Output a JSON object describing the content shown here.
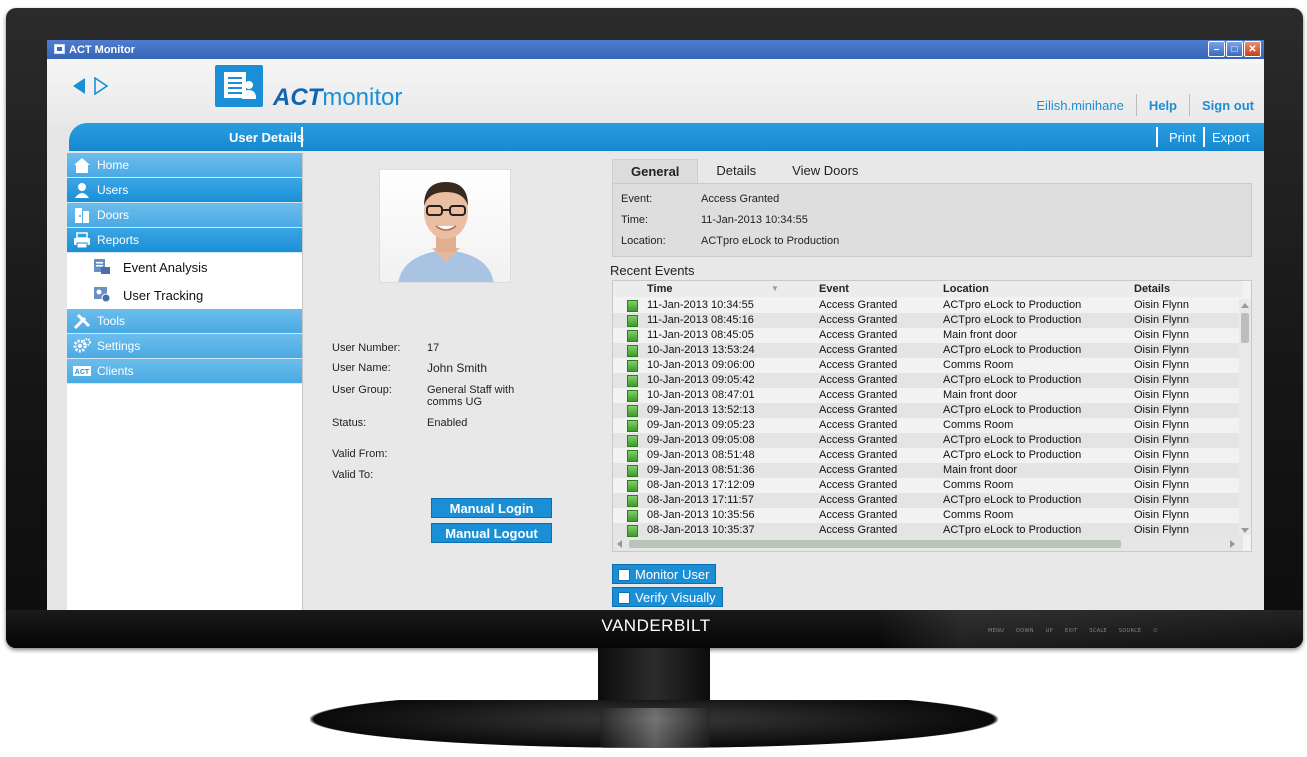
{
  "window": {
    "title": "ACT Monitor"
  },
  "header": {
    "logo_act": "ACT",
    "logo_monitor": "monitor",
    "username": "Eilish.minihane",
    "help": "Help",
    "sign_out": "Sign out"
  },
  "toolbar": {
    "section_title": "User Details",
    "print": "Print",
    "export": "Export"
  },
  "sidebar": {
    "items": [
      {
        "label": "Home"
      },
      {
        "label": "Users"
      },
      {
        "label": "Doors"
      },
      {
        "label": "Reports"
      },
      {
        "label": "Event Analysis"
      },
      {
        "label": "User Tracking"
      },
      {
        "label": "Tools"
      },
      {
        "label": "Settings"
      },
      {
        "label": "Clients"
      }
    ]
  },
  "user": {
    "number_label": "User Number:",
    "number": "17",
    "name_label": "User Name:",
    "name": "John Smith",
    "group_label": "User Group:",
    "group": "General Staff with comms UG",
    "status_label": "Status:",
    "status": "Enabled",
    "valid_from_label": "Valid From:",
    "valid_to_label": "Valid To:",
    "manual_login": "Manual Login",
    "manual_logout": "Manual Logout"
  },
  "tabs": [
    "General",
    "Details",
    "View Doors"
  ],
  "general": {
    "event_label": "Event:",
    "event": "Access Granted",
    "time_label": "Time:",
    "time": "11-Jan-2013 10:34:55",
    "location_label": "Location:",
    "location": "ACTpro eLock to Production"
  },
  "recent": {
    "title": "Recent Events",
    "columns": [
      "Time",
      "Event",
      "Location",
      "Details"
    ],
    "rows": [
      [
        "11-Jan-2013 10:34:55",
        "Access Granted",
        "ACTpro eLock to Production",
        "Oisin Flynn"
      ],
      [
        "11-Jan-2013 08:45:16",
        "Access Granted",
        "ACTpro eLock to Production",
        "Oisin Flynn"
      ],
      [
        "11-Jan-2013 08:45:05",
        "Access Granted",
        "Main front door",
        "Oisin Flynn"
      ],
      [
        "10-Jan-2013 13:53:24",
        "Access Granted",
        "ACTpro eLock to Production",
        "Oisin Flynn"
      ],
      [
        "10-Jan-2013 09:06:00",
        "Access Granted",
        "Comms Room",
        "Oisin Flynn"
      ],
      [
        "10-Jan-2013 09:05:42",
        "Access Granted",
        "ACTpro eLock to Production",
        "Oisin Flynn"
      ],
      [
        "10-Jan-2013 08:47:01",
        "Access Granted",
        "Main front door",
        "Oisin Flynn"
      ],
      [
        "09-Jan-2013 13:52:13",
        "Access Granted",
        "ACTpro eLock to Production",
        "Oisin Flynn"
      ],
      [
        "09-Jan-2013 09:05:23",
        "Access Granted",
        "Comms Room",
        "Oisin Flynn"
      ],
      [
        "09-Jan-2013 09:05:08",
        "Access Granted",
        "ACTpro eLock to Production",
        "Oisin Flynn"
      ],
      [
        "09-Jan-2013 08:51:48",
        "Access Granted",
        "ACTpro eLock to Production",
        "Oisin Flynn"
      ],
      [
        "09-Jan-2013 08:51:36",
        "Access Granted",
        "Main front door",
        "Oisin Flynn"
      ],
      [
        "08-Jan-2013 17:12:09",
        "Access Granted",
        "Comms Room",
        "Oisin Flynn"
      ],
      [
        "08-Jan-2013 17:11:57",
        "Access Granted",
        "ACTpro eLock to Production",
        "Oisin Flynn"
      ],
      [
        "08-Jan-2013 10:35:56",
        "Access Granted",
        "Comms Room",
        "Oisin Flynn"
      ],
      [
        "08-Jan-2013 10:35:37",
        "Access Granted",
        "ACTpro eLock to Production",
        "Oisin Flynn"
      ]
    ]
  },
  "options": {
    "monitor_user": "Monitor User",
    "verify_visually": "Verify Visually"
  },
  "monitor": {
    "brand": "VANDERBILT",
    "buttons": [
      "MENU",
      "DOWN",
      "UP",
      "EXIT",
      "SCALE",
      "SOURCE"
    ]
  },
  "colors": {
    "accent": "#1b8fd6",
    "titlebar": "#3565b8",
    "status_ok": "#3e9b2a"
  }
}
